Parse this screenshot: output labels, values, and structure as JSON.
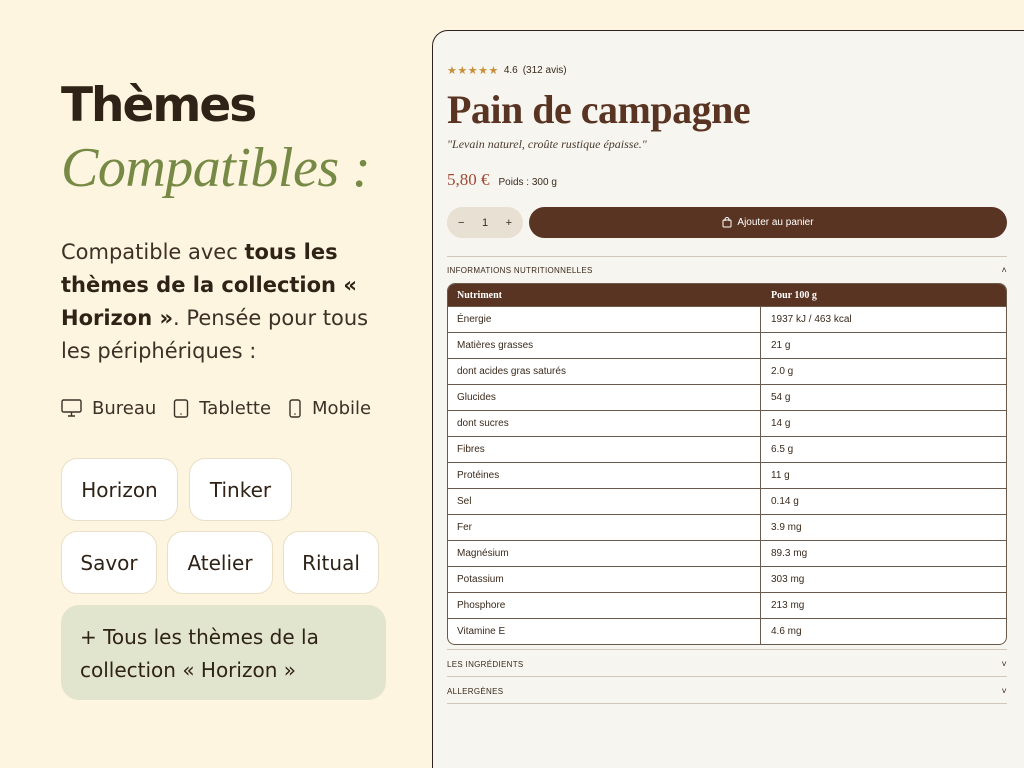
{
  "left": {
    "title": "Thèmes",
    "subtitle": "Compatibles :",
    "desc_prefix": "Compatible avec ",
    "desc_bold": "tous les thèmes de la collection « Horizon »",
    "desc_suffix": ". Pensée pour tous les périphériques :",
    "devices": [
      {
        "icon": "desktop-icon",
        "label": "Bureau"
      },
      {
        "icon": "tablet-icon",
        "label": "Tablette"
      },
      {
        "icon": "mobile-icon",
        "label": "Mobile"
      }
    ],
    "themes": [
      "Horizon",
      "Tinker",
      "Savor",
      "Atelier",
      "Ritual"
    ],
    "more_themes": "+ Tous les thèmes de la collection « Horizon »"
  },
  "product": {
    "rating": "4.6",
    "rating_count": "(312 avis)",
    "stars": "★★★★★",
    "title": "Pain de campagne",
    "tagline": "\"Levain naturel, croûte rustique épaisse.\"",
    "price": "5,80 €",
    "weight": "Poids : 300 g",
    "qty_minus": "−",
    "qty_value": "1",
    "qty_plus": "+",
    "add_to_cart": "Ajouter au panier",
    "nutrition_label": "INFORMATIONS NUTRITIONNELLES",
    "ingredients_label": "LES INGRÉDIENTS",
    "allergens_label": "ALLERGÈNES",
    "chev_up": "˄",
    "chev_down": "˅"
  },
  "nutrition": {
    "headers": [
      "Nutriment",
      "Pour 100 g"
    ],
    "rows": [
      [
        "Énergie",
        "1937 kJ / 463 kcal"
      ],
      [
        "Matières grasses",
        "21 g"
      ],
      [
        "dont acides gras saturés",
        "2.0 g"
      ],
      [
        "Glucides",
        "54 g"
      ],
      [
        "dont sucres",
        "14 g"
      ],
      [
        "Fibres",
        "6.5 g"
      ],
      [
        "Protéines",
        "11 g"
      ],
      [
        "Sel",
        "0.14 g"
      ],
      [
        "Fer",
        "3.9 mg"
      ],
      [
        "Magnésium",
        "89.3 mg"
      ],
      [
        "Potassium",
        "303 mg"
      ],
      [
        "Phosphore",
        "213 mg"
      ],
      [
        "Vitamine E",
        "4.6 mg"
      ]
    ]
  },
  "colors": {
    "background": "#fdf5df",
    "accent_green": "#768a45",
    "brown": "#5a3422",
    "price_red": "#a14a35",
    "star_gold": "#c98f3a"
  }
}
